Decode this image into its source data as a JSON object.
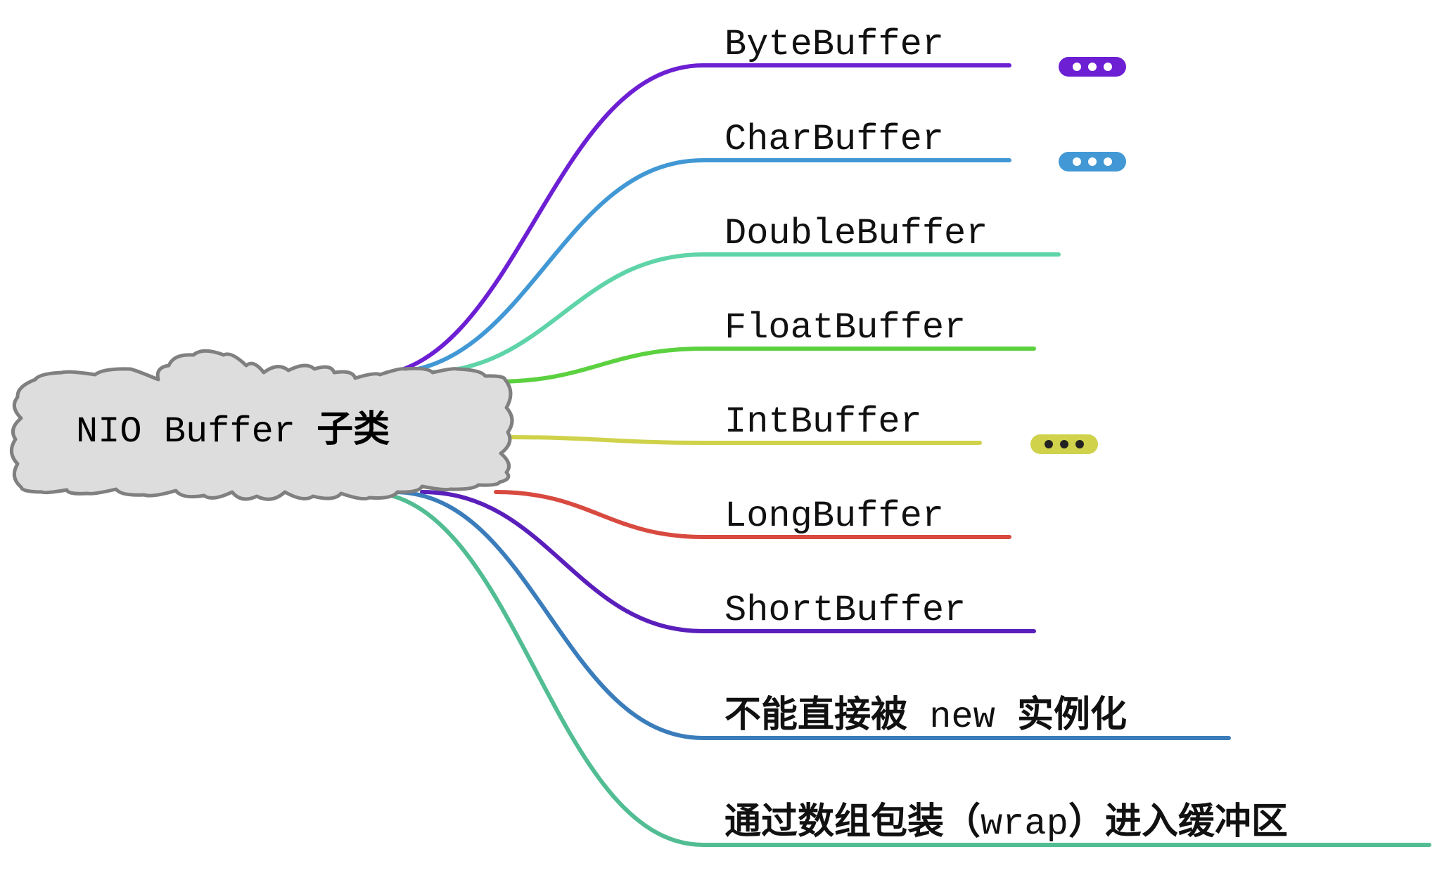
{
  "root": {
    "label_mono": "NIO Buffer",
    "label_cjk": "子类",
    "fill": "#dddddd",
    "stroke": "#808080"
  },
  "branches": [
    {
      "parts": [
        {
          "text": "ByteBuffer",
          "style": "mono"
        }
      ],
      "color": "#6d1fd3",
      "collapsed": true,
      "toggle_fill": "#6d1fd3",
      "dot_color": "#ffffff"
    },
    {
      "parts": [
        {
          "text": "CharBuffer",
          "style": "mono"
        }
      ],
      "color": "#4198d5",
      "collapsed": true,
      "toggle_fill": "#4198d5",
      "dot_color": "#ffffff"
    },
    {
      "parts": [
        {
          "text": "DoubleBuffer",
          "style": "mono"
        }
      ],
      "color": "#5fd4a8",
      "collapsed": false
    },
    {
      "parts": [
        {
          "text": "FloatBuffer",
          "style": "mono"
        }
      ],
      "color": "#5cd140",
      "collapsed": false
    },
    {
      "parts": [
        {
          "text": "IntBuffer",
          "style": "mono"
        }
      ],
      "color": "#cfd24a",
      "collapsed": true,
      "toggle_fill": "#cfd24a",
      "dot_color": "#222222"
    },
    {
      "parts": [
        {
          "text": "LongBuffer",
          "style": "mono"
        }
      ],
      "color": "#d84a40",
      "collapsed": false
    },
    {
      "parts": [
        {
          "text": "ShortBuffer",
          "style": "mono"
        }
      ],
      "color": "#5a1fbb",
      "collapsed": false
    },
    {
      "parts": [
        {
          "text": "不能直接被",
          "style": "cjk"
        },
        {
          "text": " new ",
          "style": "mono"
        },
        {
          "text": "实例化",
          "style": "cjk"
        }
      ],
      "color": "#3b7dbb",
      "collapsed": false
    },
    {
      "parts": [
        {
          "text": "通过数组包装（",
          "style": "cjk"
        },
        {
          "text": "wrap",
          "style": "mono"
        },
        {
          "text": "）进入缓冲区",
          "style": "cjk"
        }
      ],
      "color": "#52bd93",
      "collapsed": false
    }
  ]
}
